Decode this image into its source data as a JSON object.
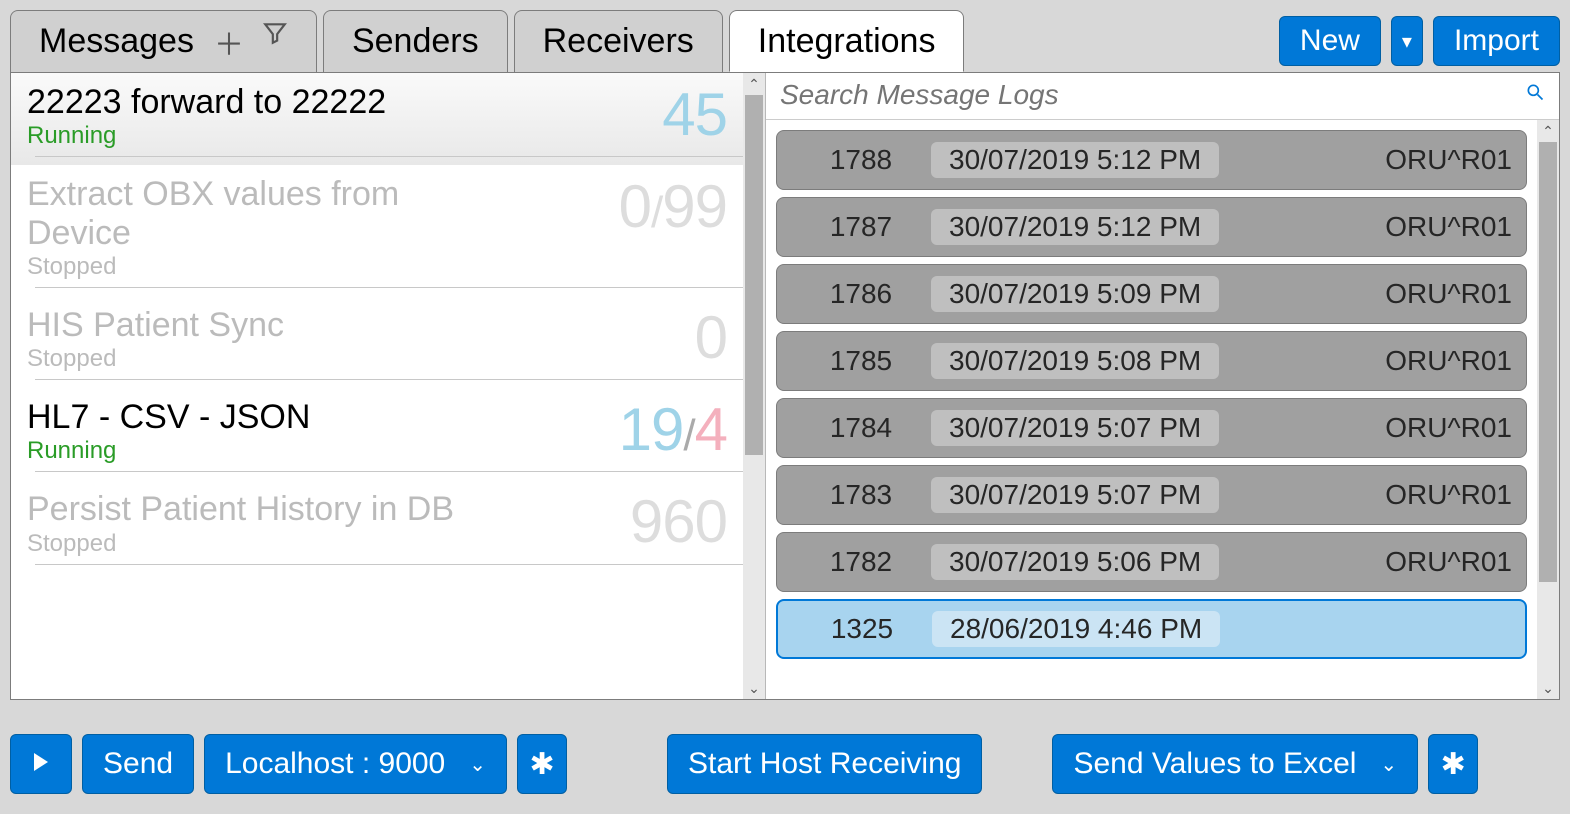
{
  "tabs": {
    "messages": "Messages",
    "senders": "Senders",
    "receivers": "Receivers",
    "integrations": "Integrations"
  },
  "top_buttons": {
    "new": "New",
    "import": "Import"
  },
  "integrations": [
    {
      "title": "22223 forward to 22222",
      "status": "Running",
      "count_html": "45",
      "dim": false,
      "count_class": "clr-blue"
    },
    {
      "title": "Extract OBX values from Device",
      "status": "Stopped",
      "count_left": "0",
      "count_sep": "/",
      "count_right": "99",
      "dim": true
    },
    {
      "title": "HIS Patient Sync",
      "status": "Stopped",
      "count_html": "0",
      "dim": true
    },
    {
      "title": "HL7 - CSV - JSON",
      "status": "Running",
      "count_left": "19",
      "count_sep": "/",
      "count_right": "4",
      "dim": false,
      "left_class": "clr-blue",
      "right_class": "clr-pink"
    },
    {
      "title": "Persist Patient History in DB",
      "status": "Stopped",
      "count_html": "960",
      "dim": true
    }
  ],
  "search_placeholder": "Search Message Logs",
  "logs": [
    {
      "id": "1788",
      "ts": "30/07/2019 5:12 PM",
      "type": "ORU^R01",
      "sel": false
    },
    {
      "id": "1787",
      "ts": "30/07/2019 5:12 PM",
      "type": "ORU^R01",
      "sel": false
    },
    {
      "id": "1786",
      "ts": "30/07/2019 5:09 PM",
      "type": "ORU^R01",
      "sel": false
    },
    {
      "id": "1785",
      "ts": "30/07/2019 5:08 PM",
      "type": "ORU^R01",
      "sel": false
    },
    {
      "id": "1784",
      "ts": "30/07/2019 5:07 PM",
      "type": "ORU^R01",
      "sel": false
    },
    {
      "id": "1783",
      "ts": "30/07/2019 5:07 PM",
      "type": "ORU^R01",
      "sel": false
    },
    {
      "id": "1782",
      "ts": "30/07/2019 5:06 PM",
      "type": "ORU^R01",
      "sel": false
    },
    {
      "id": "1325",
      "ts": "28/06/2019 4:46 PM",
      "type": "",
      "sel": true
    }
  ],
  "toolbar": {
    "send": "Send",
    "host": "Localhost : 9000",
    "start_recv": "Start Host Receiving",
    "send_excel": "Send Values to Excel"
  }
}
